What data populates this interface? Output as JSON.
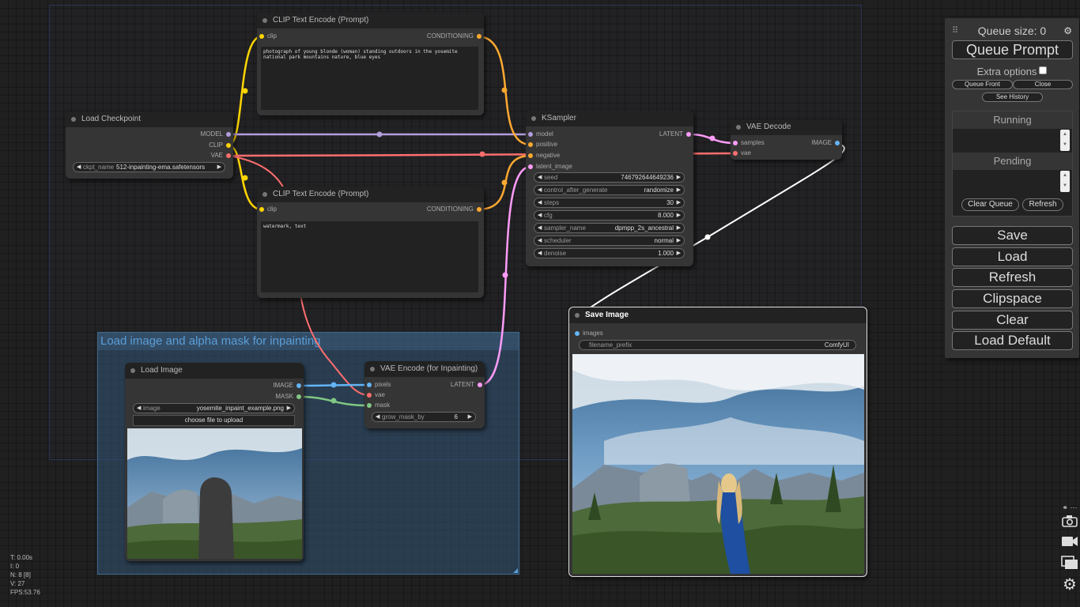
{
  "groups": {
    "inpaint_title": "Load image and alpha mask for inpainting"
  },
  "nodes": {
    "clip_top": {
      "title": "CLIP Text Encode (Prompt)",
      "input_clip": "clip",
      "output": "CONDITIONING",
      "text": "photograph of young blonde (woman) standing outdoors in the yosemite national park mountains nature, blue eyes"
    },
    "clip_bottom": {
      "title": "CLIP Text Encode (Prompt)",
      "input_clip": "clip",
      "output": "CONDITIONING",
      "text": "watermark, text"
    },
    "load_checkpoint": {
      "title": "Load Checkpoint",
      "outputs": [
        "MODEL",
        "CLIP",
        "VAE"
      ],
      "ckpt_name_label": "ckpt_name",
      "ckpt_name_value": "512-inpainting-ema.safetensors"
    },
    "ksampler": {
      "title": "KSampler",
      "inputs": [
        "model",
        "positive",
        "negative",
        "latent_image"
      ],
      "output": "LATENT",
      "widgets": [
        {
          "name": "seed",
          "value": "746792644649236"
        },
        {
          "name": "control_after_generate",
          "value": "randomize"
        },
        {
          "name": "steps",
          "value": "30"
        },
        {
          "name": "cfg",
          "value": "8.000"
        },
        {
          "name": "sampler_name",
          "value": "dpmpp_2s_ancestral"
        },
        {
          "name": "scheduler",
          "value": "normal"
        },
        {
          "name": "denoise",
          "value": "1.000"
        }
      ]
    },
    "vae_decode": {
      "title": "VAE Decode",
      "inputs": [
        "samples",
        "vae"
      ],
      "output": "IMAGE"
    },
    "save_image": {
      "title": "Save Image",
      "input": "images",
      "filename_prefix_label": "filename_prefix",
      "filename_prefix_value": "ComfyUI"
    },
    "load_image": {
      "title": "Load Image",
      "outputs": [
        "IMAGE",
        "MASK"
      ],
      "image_label": "image",
      "image_value": "yosemite_inpaint_example.png",
      "upload_label": "choose file to upload"
    },
    "vae_encode": {
      "title": "VAE Encode (for Inpainting)",
      "inputs": [
        "pixels",
        "vae",
        "mask"
      ],
      "output": "LATENT",
      "grow_label": "grow_mask_by",
      "grow_value": "6"
    }
  },
  "menu": {
    "queue_size": "Queue size: 0",
    "queue_prompt": "Queue Prompt",
    "extra_options": "Extra options",
    "queue_front": "Queue Front",
    "close": "Close",
    "see_history": "See History",
    "running": "Running",
    "pending": "Pending",
    "clear_queue": "Clear Queue",
    "refresh_small": "Refresh",
    "save": "Save",
    "load": "Load",
    "refresh": "Refresh",
    "clipspace": "Clipspace",
    "clear": "Clear",
    "load_default": "Load Default"
  },
  "stats": {
    "t": "T: 0.00s",
    "i": "I: 0",
    "n": "N: 8 [8]",
    "v": "V: 27",
    "fps": "FPS:53.76"
  },
  "colors": {
    "model": "#b39ddb",
    "clip": "#ffd500",
    "vae": "#ff6e6e",
    "conditioning": "#ffa931",
    "latent": "#ff9cf9",
    "image": "#64b5f6",
    "mask": "#81c784"
  },
  "icons": [
    "drag-handle-icon",
    "gear-icon",
    "share-icon",
    "camera-icon",
    "video-icon",
    "gallery-icon",
    "settings-icon"
  ]
}
